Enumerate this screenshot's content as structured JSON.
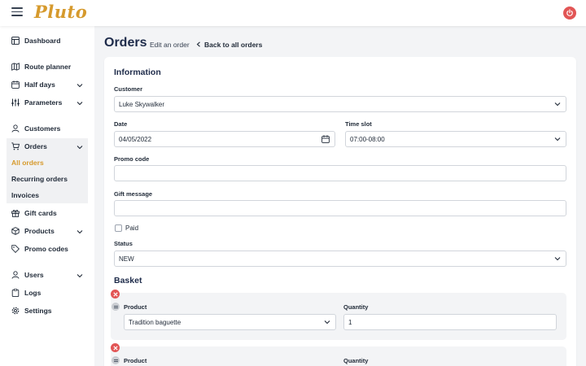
{
  "header": {
    "logo_text": "Pluto",
    "menu_icon": "hamburger-icon",
    "power_icon": "power-icon",
    "accent_color": "#d69a2d",
    "power_color": "#e25555"
  },
  "sidebar": {
    "items": [
      {
        "label": "Dashboard",
        "icon": "dashboard-icon"
      },
      {
        "label": "Route planner",
        "icon": "map-icon"
      },
      {
        "label": "Half days",
        "icon": "calendar-icon"
      },
      {
        "label": "Parameters",
        "icon": "sliders-icon"
      },
      {
        "label": "Customers",
        "icon": "user-icon"
      },
      {
        "label": "Orders",
        "icon": "cart-icon"
      },
      {
        "label": "Gift cards",
        "icon": "gift-icon"
      },
      {
        "label": "Products",
        "icon": "cube-icon"
      },
      {
        "label": "Promo codes",
        "icon": "tag-icon"
      },
      {
        "label": "Users",
        "icon": "users-icon"
      },
      {
        "label": "Logs",
        "icon": "clipboard-icon"
      },
      {
        "label": "Settings",
        "icon": "gear-icon"
      }
    ],
    "orders_sub": [
      "All orders",
      "Recurring orders",
      "Invoices"
    ],
    "active_sub": "All orders"
  },
  "main": {
    "title": "Orders",
    "subtitle": "Edit an order",
    "back_link": "Back to all orders"
  },
  "information": {
    "title": "Information",
    "customer_label": "Customer",
    "customer_value": "Luke Skywalker",
    "date_label": "Date",
    "date_value": "04/05/2022",
    "timeslot_label": "Time slot",
    "timeslot_value": "07:00-08:00",
    "promo_label": "Promo code",
    "promo_value": "",
    "gift_label": "Gift message",
    "gift_value": "",
    "paid_label": "Paid",
    "paid_checked": false,
    "status_label": "Status",
    "status_value": "NEW"
  },
  "basket": {
    "title": "Basket",
    "product_label": "Product",
    "quantity_label": "Quantity",
    "items": [
      {
        "product": "Tradition baguette",
        "quantity": "1"
      },
      {
        "product": "",
        "quantity": ""
      }
    ]
  }
}
